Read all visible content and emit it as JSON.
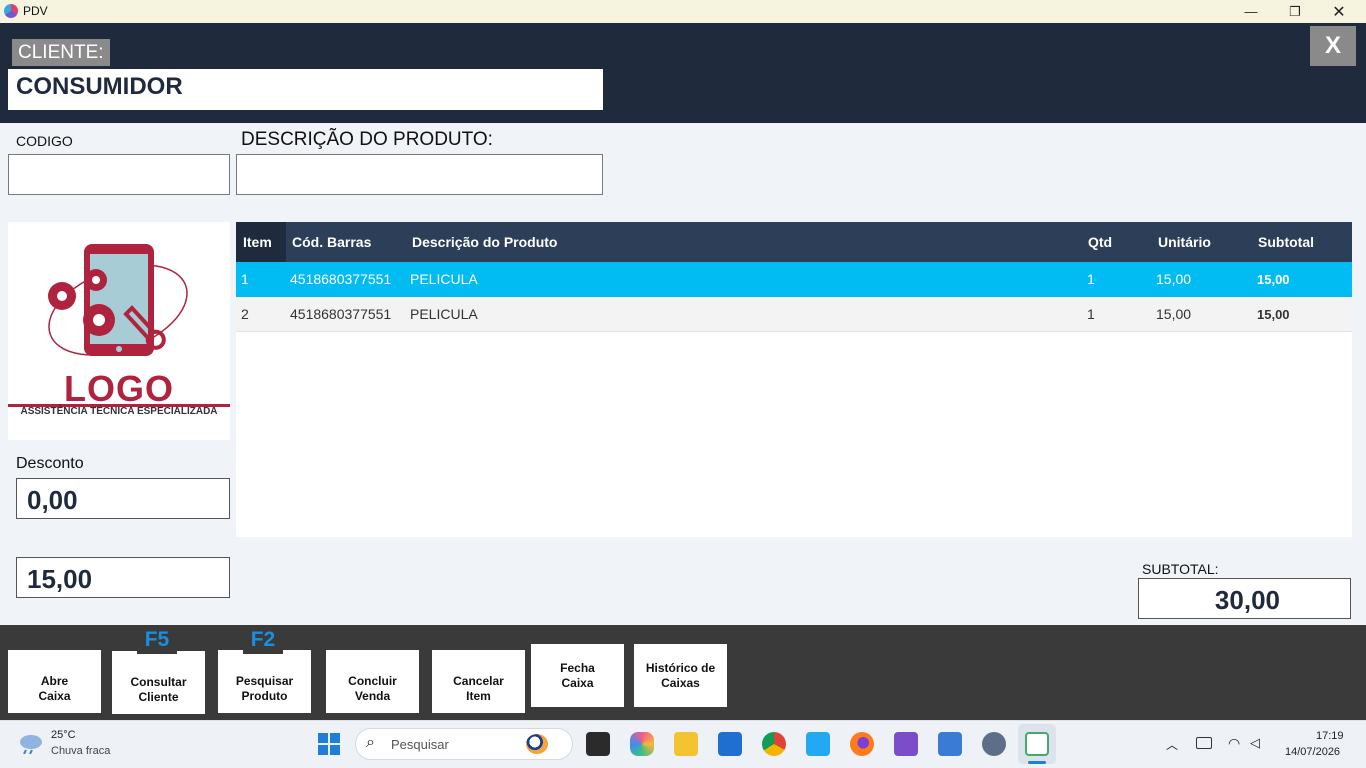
{
  "window": {
    "title": "PDV",
    "minimize_icon": "minimize-icon",
    "maximize_icon": "restore-icon",
    "close_icon": "close-icon"
  },
  "header": {
    "cliente_label": "CLIENTE:",
    "cliente_value": "CONSUMIDOR",
    "close_button": "X"
  },
  "product_entry": {
    "codigo_label": "CODIGO",
    "codigo_value": "",
    "descricao_label": "DESCRIÇÃO DO PRODUTO:",
    "descricao_value": ""
  },
  "logo": {
    "title": "LOGO",
    "subtitle": "ASSISTÊNCIA TÉCNICA ESPECIALIZADA"
  },
  "desconto": {
    "label": "Desconto",
    "value": "0,00"
  },
  "total_left": {
    "value": "15,00"
  },
  "grid": {
    "columns": [
      "Item",
      "Cód. Barras",
      "Descrição do Produto",
      "Qtd",
      "Unitário",
      "Subtotal"
    ],
    "rows": [
      {
        "item": "1",
        "barcode": "4518680377551",
        "description": "PELICULA",
        "qtd": "1",
        "unit": "15,00",
        "subtotal": "15,00",
        "selected": true
      },
      {
        "item": "2",
        "barcode": "4518680377551",
        "description": "PELICULA",
        "qtd": "1",
        "unit": "15,00",
        "subtotal": "15,00",
        "selected": false
      }
    ]
  },
  "subtotal": {
    "label": "SUBTOTAL:",
    "value": "30,00"
  },
  "toolbar": {
    "f5": "F5",
    "f2": "F2",
    "abre_caixa": "Abre\nCaixa",
    "consultar_cliente": "Consultar\nCliente",
    "pesquisar_produto": "Pesquisar\nProduto",
    "concluir_venda": "Concluir\nVenda",
    "cancelar_item": "Cancelar\nItem",
    "fecha_caixa": "Fecha\nCaixa",
    "historico_caixas": "Histórico de\nCaixas"
  },
  "taskbar": {
    "weather_temp": "25°C",
    "weather_desc": "Chuva fraca",
    "search_placeholder": "Pesquisar",
    "time": "17:19",
    "date": "14/07/2026"
  },
  "colors": {
    "header_bg": "#1f2a3c",
    "selected_row": "#00bcf2",
    "grid_header": "#2d3f58",
    "fkey": "#1a8fe0",
    "logo": "#b0233f"
  }
}
